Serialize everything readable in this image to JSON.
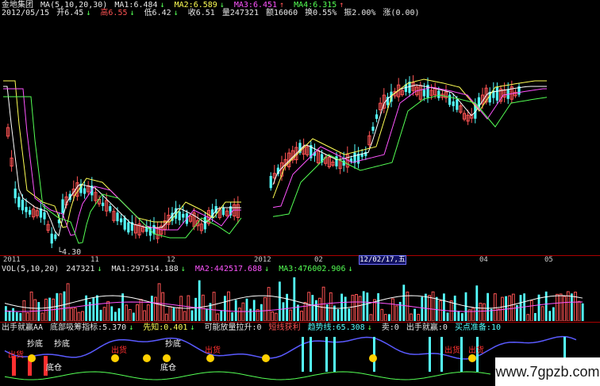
{
  "stock_name": "金地集团",
  "ma_header": {
    "params": "MA(5,10,20,30)",
    "ma1": "MA1:6.484",
    "ma2": "MA2:6.589",
    "ma3": "MA3:6.451",
    "ma4": "MA4:6.315"
  },
  "info_line": {
    "date": "2012/05/15",
    "open": "开6.45",
    "high": "高6.55",
    "low": "低6.42",
    "close": "收6.51",
    "volume": "量247321",
    "amount": "额16060",
    "turnover": "换0.55%",
    "amplitude": "振2.00%",
    "change": "涨(0.00)"
  },
  "low_price_label": "4.30",
  "date_axis": {
    "labels": [
      "2011",
      "11",
      "12",
      "2012",
      "02",
      "04",
      "05"
    ],
    "highlight": "12/02/17,五"
  },
  "vol_header": {
    "params": "VOL(5,10,20)",
    "value": "247321",
    "ma1": "MA1:297514.188",
    "ma2": "MA2:442517.688",
    "ma3": "MA3:476002.906"
  },
  "indicator_header": {
    "title": "出手就赢AA",
    "items": [
      "底部吸筹指标:5.370",
      "先知:0.401",
      "可能放量拉升:0",
      "短线获利",
      "趋势线:65.308",
      "卖:0",
      "出手就赢:0",
      "买点准备:10"
    ]
  },
  "indicator_labels": [
    "抄底",
    "抄底",
    "抄底",
    "出货",
    "出货",
    "出货",
    "出货",
    "出货",
    "底仓",
    "底仓"
  ],
  "watermark": "www.7gpzb.com",
  "colors": {
    "up": "#ff5454",
    "down": "#54ffff",
    "ma1": "#ffffff",
    "ma2": "#ffff54",
    "ma3": "#ff54ff",
    "ma4": "#54ff54"
  },
  "chart_data": {
    "type": "candlestick",
    "date_range": [
      "2011",
      "2012/05/15"
    ],
    "last": {
      "open": 6.45,
      "high": 6.55,
      "low": 6.42,
      "close": 6.51,
      "volume": 247321
    },
    "price_low_marked": 4.3,
    "moving_averages": [
      {
        "name": "MA1",
        "period": 5,
        "value": 6.484
      },
      {
        "name": "MA2",
        "period": 10,
        "value": 6.589
      },
      {
        "name": "MA3",
        "period": 20,
        "value": 6.451
      },
      {
        "name": "MA4",
        "period": 30,
        "value": 6.315
      }
    ],
    "volume_mas": [
      {
        "name": "MA1",
        "period": 5,
        "value": 297514.188
      },
      {
        "name": "MA2",
        "period": 10,
        "value": 442517.688
      },
      {
        "name": "MA3",
        "period": 20,
        "value": 476002.906
      }
    ]
  }
}
